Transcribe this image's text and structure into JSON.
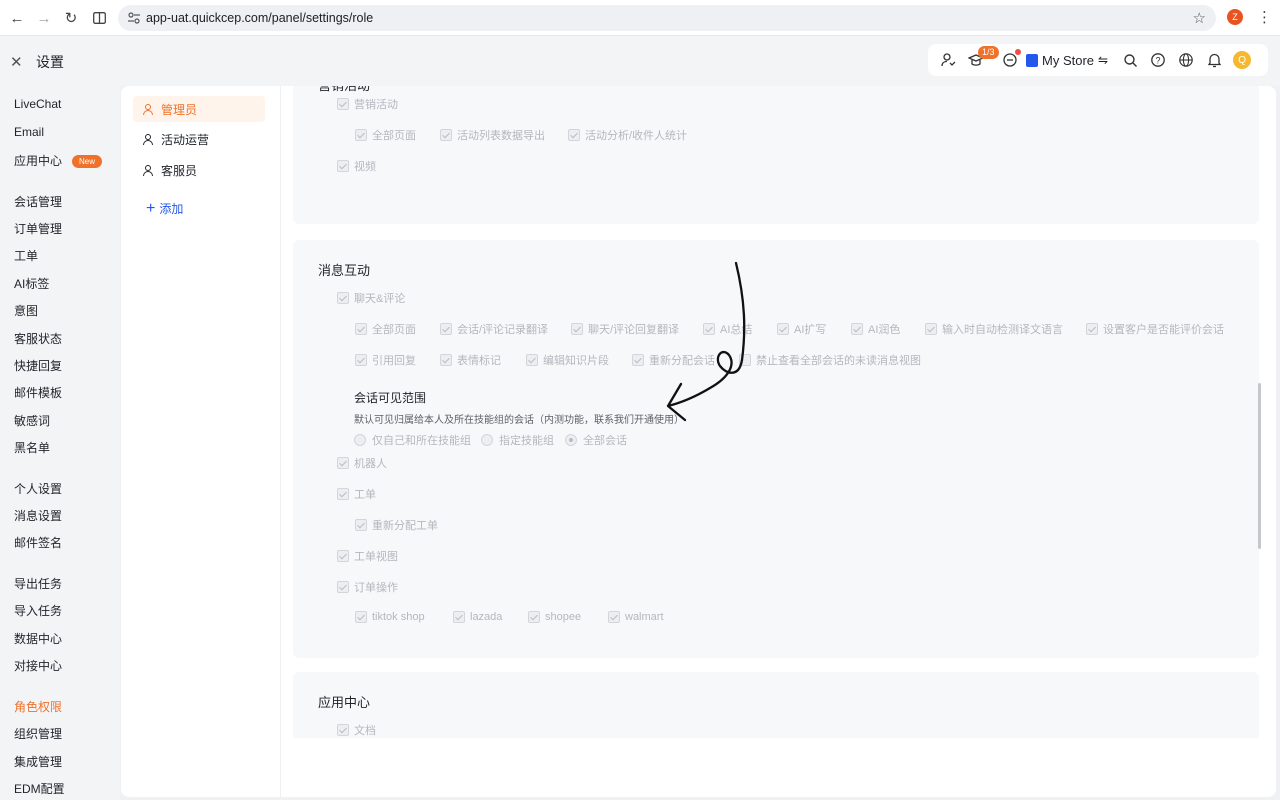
{
  "browser": {
    "url": "app-uat.quickcep.com/panel/settings/role",
    "profile_initial": "Z"
  },
  "header": {
    "title": "设置",
    "course_badge": "1/3",
    "store_name": "My Store",
    "avatar_initial": "Q"
  },
  "nav": {
    "livechat": "LiveChat",
    "email": "Email",
    "app_center": "应用中心",
    "new_badge": "New",
    "conversation": "会话管理",
    "orders": "订单管理",
    "tickets": "工单",
    "ai_tags": "AI标签",
    "intent": "意图",
    "agent_status": "客服状态",
    "quick_reply": "快捷回复",
    "mail_template": "邮件模板",
    "sensitive_words": "敏感词",
    "blacklist": "黑名单",
    "personal": "个人设置",
    "message_settings": "消息设置",
    "mail_signature": "邮件签名",
    "export_tasks": "导出任务",
    "import_tasks": "导入任务",
    "data_center": "数据中心",
    "integration_center": "对接中心",
    "roles": "角色权限",
    "organization": "组织管理",
    "integrations": "集成管理",
    "edm": "EDM配置"
  },
  "roles": {
    "admin": "管理员",
    "operations": "活动运营",
    "agent": "客服员",
    "add": "添加"
  },
  "marketing": {
    "title_partial": "营销活动",
    "activity": "营销活动",
    "all_pages": "全部页面",
    "export_list": "活动列表数据导出",
    "analysis": "活动分析/收件人统计",
    "video": "视频"
  },
  "messaging": {
    "title": "消息互动",
    "chat_review": "聊天&评论",
    "all_pages": "全部页面",
    "translate_history": "会话/评论记录翻译",
    "reply_translate": "聊天/评论回复翻译",
    "ai_summary": "AI总结",
    "ai_expand": "AI扩写",
    "ai_polish": "AI润色",
    "auto_detect": "输入时自动检测译文语言",
    "allow_rating": "设置客户是否能评价会话",
    "quote_reply": "引用回复",
    "emoji_mark": "表情标记",
    "edit_knowledge": "编辑知识片段",
    "reassign_chat": "重新分配会话",
    "no_unread_view": "禁止查看全部会话的未读消息视图",
    "visibility_title": "会话可见范围",
    "visibility_desc": "默认可见归属给本人及所在技能组的会话（内测功能，联系我们开通使用）",
    "radio_own": "仅自己和所在技能组",
    "radio_group": "指定技能组",
    "radio_all": "全部会话",
    "robot": "机器人",
    "ticket": "工单",
    "reassign_ticket": "重新分配工单",
    "ticket_view": "工单视图",
    "order_ops": "订单操作",
    "tiktok": "tiktok shop",
    "lazada": "lazada",
    "shopee": "shopee",
    "walmart": "walmart"
  },
  "app_center_section": {
    "title": "应用中心",
    "docs": "文档"
  }
}
